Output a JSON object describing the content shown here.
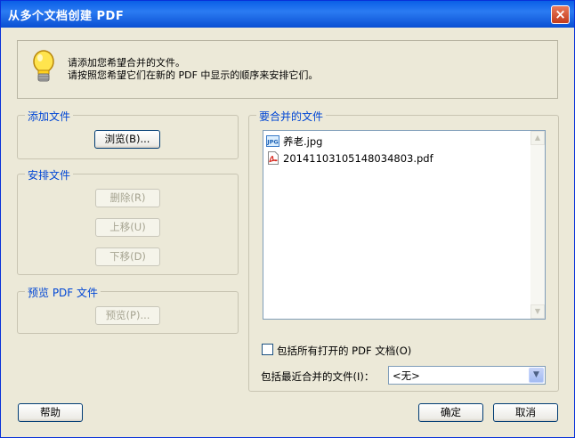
{
  "window": {
    "title": "从多个文档创建 PDF",
    "close_symbol": "×"
  },
  "info": {
    "line1": "请添加您希望合并的文件。",
    "line2": "请按照您希望它们在新的 PDF 中显示的顺序来安排它们。"
  },
  "add_group": {
    "title": "添加文件",
    "browse_label": "浏览(B)..."
  },
  "arrange_group": {
    "title": "安排文件",
    "delete_label": "删除(R)",
    "move_up_label": "上移(U)",
    "move_down_label": "下移(D)"
  },
  "preview_group": {
    "title": "预览 PDF 文件",
    "preview_label": "预览(P)..."
  },
  "merge_group": {
    "title": "要合并的文件",
    "files": [
      {
        "name": "养老.jpg",
        "icon": "jpg-file-icon"
      },
      {
        "name": "20141103105148034803.pdf",
        "icon": "pdf-file-icon"
      }
    ]
  },
  "include_open": {
    "label": "包括所有打开的 PDF 文档(O)",
    "checked": false
  },
  "recent": {
    "label": "包括最近合并的文件(I)：",
    "value": "<无>"
  },
  "footer": {
    "help_label": "帮助",
    "ok_label": "确定",
    "cancel_label": "取消"
  },
  "colors": {
    "titlebar": "#0a5fe6",
    "group_title": "#0046d5",
    "dialog_bg": "#ece9d8"
  }
}
